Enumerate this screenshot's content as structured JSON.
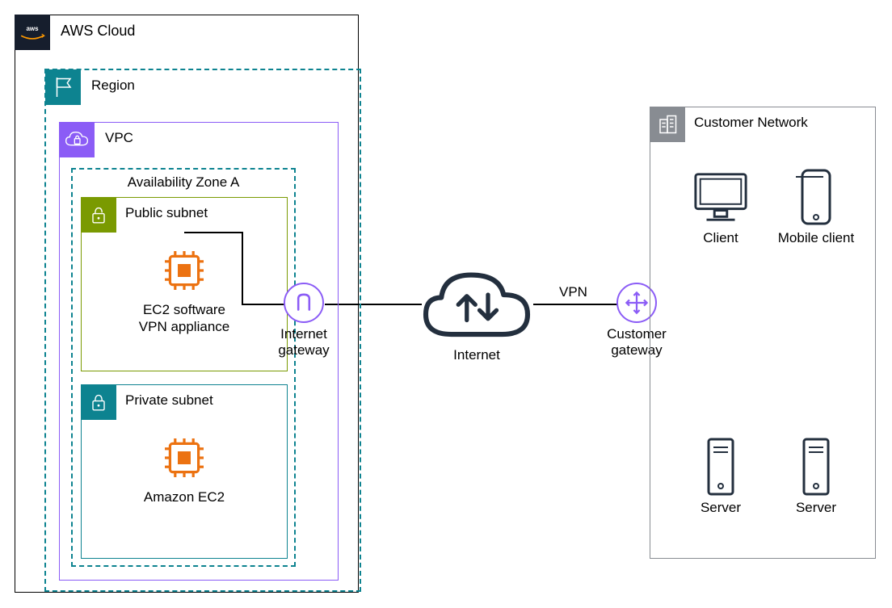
{
  "aws_cloud_label": "AWS Cloud",
  "region_label": "Region",
  "vpc_label": "VPC",
  "az_label": "Availability Zone A",
  "public_subnet_label": "Public subnet",
  "private_subnet_label": "Private subnet",
  "ec2_appliance_caption": "EC2 software\nVPN appliance",
  "ec2_private_caption": "Amazon EC2",
  "igw_caption": "Internet\ngateway",
  "internet_caption": "Internet",
  "vpn_label": "VPN",
  "cgw_caption": "Customer\ngateway",
  "customer_network_label": "Customer Network",
  "client_caption": "Client",
  "mobile_client_caption": "Mobile client",
  "server1_caption": "Server",
  "server2_caption": "Server"
}
